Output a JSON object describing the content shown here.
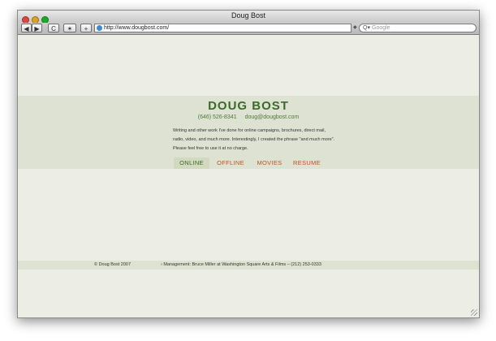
{
  "window": {
    "title": "Doug Bost"
  },
  "toolbar": {
    "back_label": "◀",
    "forward_label": "▶",
    "reload_label": "C",
    "snapback_label": "✶",
    "add_label": "+",
    "url": "http://www.dougbost.com/",
    "search_placeholder": "Google"
  },
  "site": {
    "name": "DOUG BOST",
    "phone": "(646) 526-8341",
    "email": "doug@dougbost.com",
    "description": "Writing and other work I've done for online campaigns, brochures, direct mail, radio, video, and much more. Interestingly, I created the phrase \"and much more\". Please feel free to use it at no charge."
  },
  "nav": [
    {
      "label": "ONLINE",
      "active": true
    },
    {
      "label": "OFFLINE",
      "active": false
    },
    {
      "label": "MOVIES",
      "active": false
    },
    {
      "label": "RESUME",
      "active": false
    }
  ],
  "footer": {
    "copyright": "© Doug Bost 2007",
    "management": "› Management: Bruce Miller at Washington Square Arts & Films  –  (212) 253-0333"
  },
  "colors": {
    "page_bg": "#eceee6",
    "band_bg": "#dee2d2",
    "brand_green": "#3b6a2a",
    "nav_orange": "#b65525",
    "nav_active_bg": "#d3d9bf"
  }
}
